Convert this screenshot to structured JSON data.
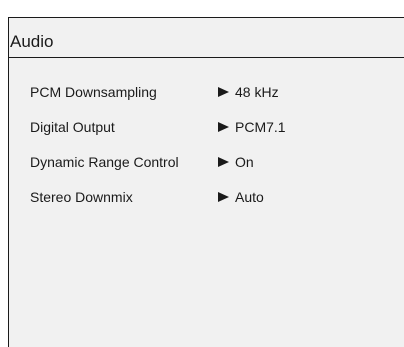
{
  "panel": {
    "title": "Audio"
  },
  "settings": [
    {
      "label": "PCM Downsampling",
      "value": "48 kHz"
    },
    {
      "label": "Digital Output",
      "value": "PCM7.1"
    },
    {
      "label": "Dynamic Range Control",
      "value": "On"
    },
    {
      "label": "Stereo Downmix",
      "value": "Auto"
    }
  ],
  "colors": {
    "panel_background": "#f1f1f1",
    "text": "#1a1a1a"
  },
  "icons": {
    "selector": "arrow-right-icon"
  }
}
